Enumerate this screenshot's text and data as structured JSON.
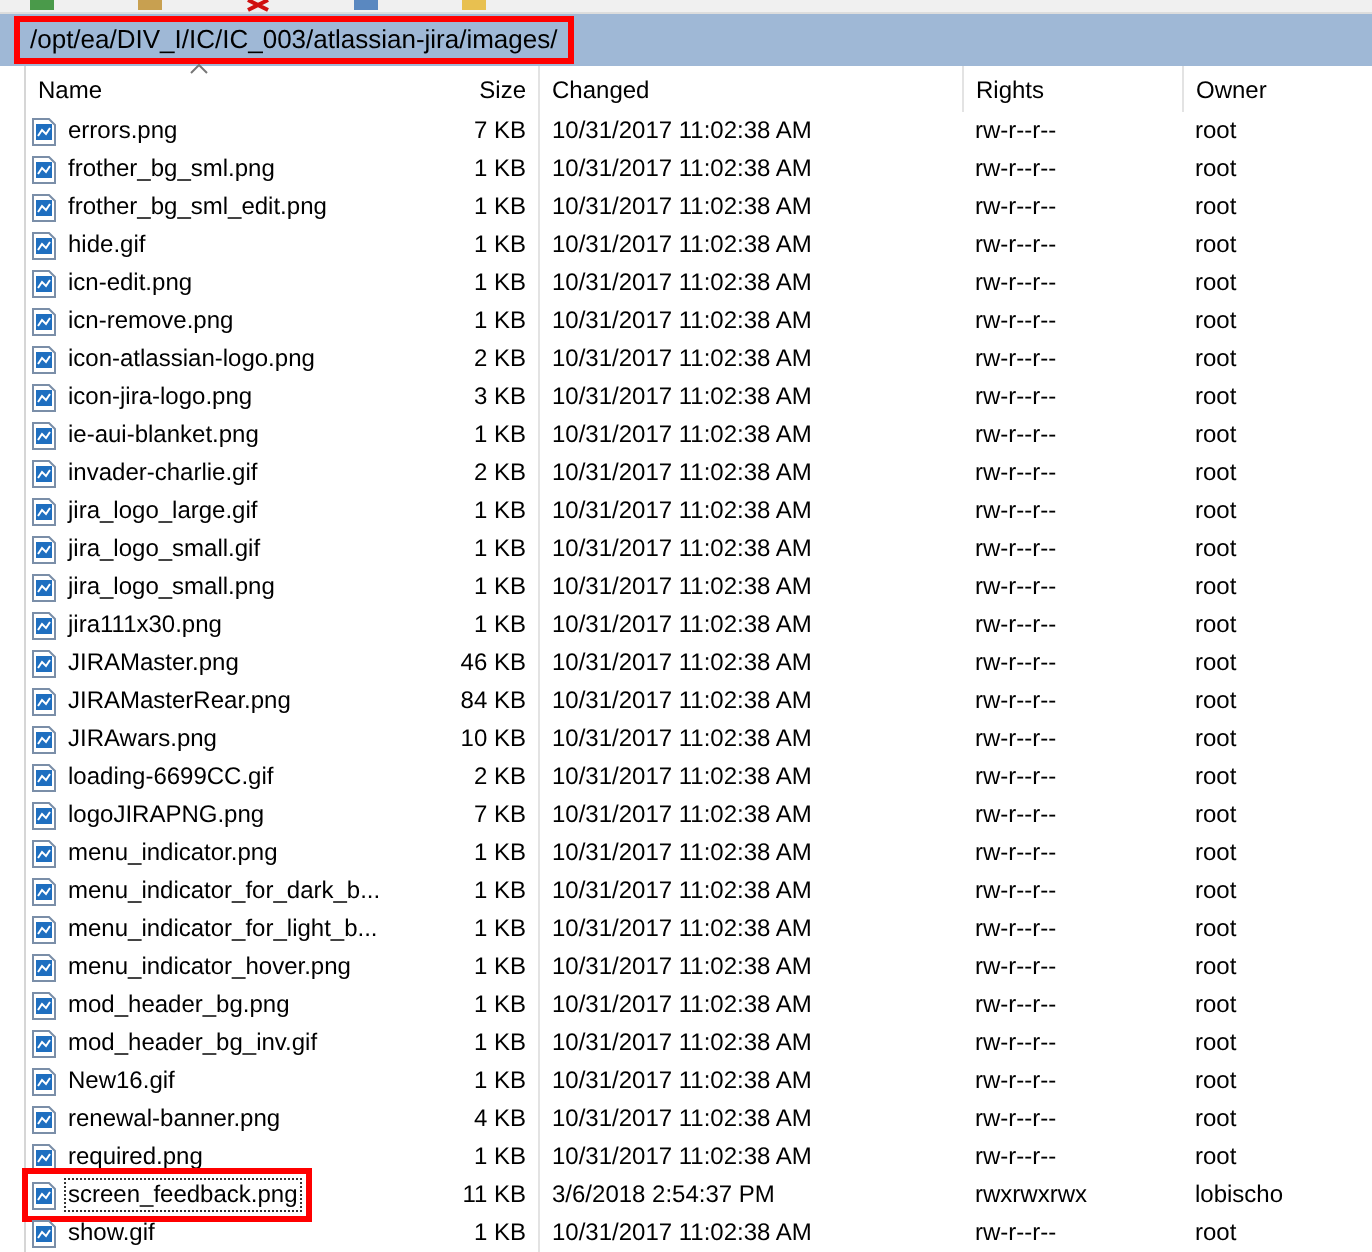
{
  "path_bar": {
    "path": "/opt/ea/DIV_I/IC/IC_003/atlassian-jira/images/",
    "highlighted": true
  },
  "columns": [
    {
      "label": "Name",
      "sorted": true
    },
    {
      "label": "Size",
      "sorted": false
    },
    {
      "label": "Changed",
      "sorted": false
    },
    {
      "label": "Rights",
      "sorted": false
    },
    {
      "label": "Owner",
      "sorted": false
    }
  ],
  "files": [
    {
      "name": "errors.png",
      "size": "7 KB",
      "changed": "10/31/2017 11:02:38 AM",
      "rights": "rw-r--r--",
      "owner": "root",
      "highlighted": false,
      "focused": false
    },
    {
      "name": "frother_bg_sml.png",
      "size": "1 KB",
      "changed": "10/31/2017 11:02:38 AM",
      "rights": "rw-r--r--",
      "owner": "root",
      "highlighted": false,
      "focused": false
    },
    {
      "name": "frother_bg_sml_edit.png",
      "size": "1 KB",
      "changed": "10/31/2017 11:02:38 AM",
      "rights": "rw-r--r--",
      "owner": "root",
      "highlighted": false,
      "focused": false
    },
    {
      "name": "hide.gif",
      "size": "1 KB",
      "changed": "10/31/2017 11:02:38 AM",
      "rights": "rw-r--r--",
      "owner": "root",
      "highlighted": false,
      "focused": false
    },
    {
      "name": "icn-edit.png",
      "size": "1 KB",
      "changed": "10/31/2017 11:02:38 AM",
      "rights": "rw-r--r--",
      "owner": "root",
      "highlighted": false,
      "focused": false
    },
    {
      "name": "icn-remove.png",
      "size": "1 KB",
      "changed": "10/31/2017 11:02:38 AM",
      "rights": "rw-r--r--",
      "owner": "root",
      "highlighted": false,
      "focused": false
    },
    {
      "name": "icon-atlassian-logo.png",
      "size": "2 KB",
      "changed": "10/31/2017 11:02:38 AM",
      "rights": "rw-r--r--",
      "owner": "root",
      "highlighted": false,
      "focused": false
    },
    {
      "name": "icon-jira-logo.png",
      "size": "3 KB",
      "changed": "10/31/2017 11:02:38 AM",
      "rights": "rw-r--r--",
      "owner": "root",
      "highlighted": false,
      "focused": false
    },
    {
      "name": "ie-aui-blanket.png",
      "size": "1 KB",
      "changed": "10/31/2017 11:02:38 AM",
      "rights": "rw-r--r--",
      "owner": "root",
      "highlighted": false,
      "focused": false
    },
    {
      "name": "invader-charlie.gif",
      "size": "2 KB",
      "changed": "10/31/2017 11:02:38 AM",
      "rights": "rw-r--r--",
      "owner": "root",
      "highlighted": false,
      "focused": false
    },
    {
      "name": "jira_logo_large.gif",
      "size": "1 KB",
      "changed": "10/31/2017 11:02:38 AM",
      "rights": "rw-r--r--",
      "owner": "root",
      "highlighted": false,
      "focused": false
    },
    {
      "name": "jira_logo_small.gif",
      "size": "1 KB",
      "changed": "10/31/2017 11:02:38 AM",
      "rights": "rw-r--r--",
      "owner": "root",
      "highlighted": false,
      "focused": false
    },
    {
      "name": "jira_logo_small.png",
      "size": "1 KB",
      "changed": "10/31/2017 11:02:38 AM",
      "rights": "rw-r--r--",
      "owner": "root",
      "highlighted": false,
      "focused": false
    },
    {
      "name": "jira111x30.png",
      "size": "1 KB",
      "changed": "10/31/2017 11:02:38 AM",
      "rights": "rw-r--r--",
      "owner": "root",
      "highlighted": false,
      "focused": false
    },
    {
      "name": "JIRAMaster.png",
      "size": "46 KB",
      "changed": "10/31/2017 11:02:38 AM",
      "rights": "rw-r--r--",
      "owner": "root",
      "highlighted": false,
      "focused": false
    },
    {
      "name": "JIRAMasterRear.png",
      "size": "84 KB",
      "changed": "10/31/2017 11:02:38 AM",
      "rights": "rw-r--r--",
      "owner": "root",
      "highlighted": false,
      "focused": false
    },
    {
      "name": "JIRAwars.png",
      "size": "10 KB",
      "changed": "10/31/2017 11:02:38 AM",
      "rights": "rw-r--r--",
      "owner": "root",
      "highlighted": false,
      "focused": false
    },
    {
      "name": "loading-6699CC.gif",
      "size": "2 KB",
      "changed": "10/31/2017 11:02:38 AM",
      "rights": "rw-r--r--",
      "owner": "root",
      "highlighted": false,
      "focused": false
    },
    {
      "name": "logoJIRAPNG.png",
      "size": "7 KB",
      "changed": "10/31/2017 11:02:38 AM",
      "rights": "rw-r--r--",
      "owner": "root",
      "highlighted": false,
      "focused": false
    },
    {
      "name": "menu_indicator.png",
      "size": "1 KB",
      "changed": "10/31/2017 11:02:38 AM",
      "rights": "rw-r--r--",
      "owner": "root",
      "highlighted": false,
      "focused": false
    },
    {
      "name": "menu_indicator_for_dark_b...",
      "size": "1 KB",
      "changed": "10/31/2017 11:02:38 AM",
      "rights": "rw-r--r--",
      "owner": "root",
      "highlighted": false,
      "focused": false
    },
    {
      "name": "menu_indicator_for_light_b...",
      "size": "1 KB",
      "changed": "10/31/2017 11:02:38 AM",
      "rights": "rw-r--r--",
      "owner": "root",
      "highlighted": false,
      "focused": false
    },
    {
      "name": "menu_indicator_hover.png",
      "size": "1 KB",
      "changed": "10/31/2017 11:02:38 AM",
      "rights": "rw-r--r--",
      "owner": "root",
      "highlighted": false,
      "focused": false
    },
    {
      "name": "mod_header_bg.png",
      "size": "1 KB",
      "changed": "10/31/2017 11:02:38 AM",
      "rights": "rw-r--r--",
      "owner": "root",
      "highlighted": false,
      "focused": false
    },
    {
      "name": "mod_header_bg_inv.gif",
      "size": "1 KB",
      "changed": "10/31/2017 11:02:38 AM",
      "rights": "rw-r--r--",
      "owner": "root",
      "highlighted": false,
      "focused": false
    },
    {
      "name": "New16.gif",
      "size": "1 KB",
      "changed": "10/31/2017 11:02:38 AM",
      "rights": "rw-r--r--",
      "owner": "root",
      "highlighted": false,
      "focused": false
    },
    {
      "name": "renewal-banner.png",
      "size": "4 KB",
      "changed": "10/31/2017 11:02:38 AM",
      "rights": "rw-r--r--",
      "owner": "root",
      "highlighted": false,
      "focused": false
    },
    {
      "name": "required.png",
      "size": "1 KB",
      "changed": "10/31/2017 11:02:38 AM",
      "rights": "rw-r--r--",
      "owner": "root",
      "highlighted": false,
      "focused": false
    },
    {
      "name": "screen_feedback.png",
      "size": "11 KB",
      "changed": "3/6/2018 2:54:37 PM",
      "rights": "rwxrwxrwx",
      "owner": "lobischo",
      "highlighted": true,
      "focused": true
    },
    {
      "name": "show.gif",
      "size": "1 KB",
      "changed": "10/31/2017 11:02:38 AM",
      "rights": "rw-r--r--",
      "owner": "root",
      "highlighted": false,
      "focused": false
    }
  ]
}
